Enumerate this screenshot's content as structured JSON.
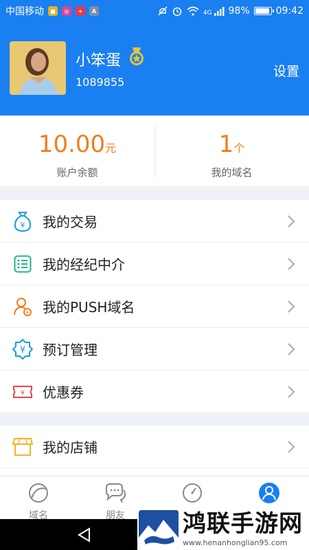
{
  "status_bar": {
    "carrier": "中国移动",
    "network": "4G",
    "battery": "98%",
    "battery_level": 0.98,
    "time": "09:42"
  },
  "profile": {
    "username": "小笨蛋",
    "user_id": "1089855",
    "settings_label": "设置"
  },
  "stats": {
    "balance_value": "10.00",
    "balance_unit": "元",
    "balance_label": "账户余额",
    "domains_value": "1",
    "domains_unit": "个",
    "domains_label": "我的域名"
  },
  "menu": {
    "items": [
      {
        "label": "我的交易",
        "icon": "money-bag-icon"
      },
      {
        "label": "我的经纪中介",
        "icon": "list-icon"
      },
      {
        "label": "我的PUSH域名",
        "icon": "user-edit-icon"
      },
      {
        "label": "预订管理",
        "icon": "yen-badge-icon"
      },
      {
        "label": "优惠券",
        "icon": "coupon-icon"
      },
      {
        "label": "我的店铺",
        "icon": "store-icon"
      }
    ]
  },
  "tabs": [
    {
      "label": "域名",
      "icon": "domain-tab-icon"
    },
    {
      "label": "朋友",
      "icon": "chat-icon"
    },
    {
      "label": "",
      "icon": "compass-icon"
    },
    {
      "label": "",
      "icon": "profile-icon",
      "active": true
    }
  ],
  "watermark": {
    "title": "鸿联手游网",
    "domain": "www.henanhonglian95.com"
  },
  "colors": {
    "primary": "#1a7ff0",
    "accent_orange": "#f07e1e"
  }
}
